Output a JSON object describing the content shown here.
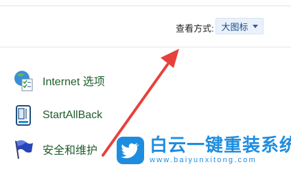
{
  "header": {
    "view_by_label": "查看方式:",
    "view_by_value": "大图标"
  },
  "items": [
    {
      "label": "Internet 选项",
      "icon": "internet-options-icon"
    },
    {
      "label": "StartAllBack",
      "icon": "startallback-icon"
    },
    {
      "label": "安全和维护",
      "icon": "flag-icon"
    }
  ],
  "watermark": {
    "title": "白云一键重装系统",
    "url": "www.baiyunxitong.com"
  },
  "colors": {
    "item_label": "#1e5d2a",
    "arrow": "#e8413b",
    "watermark": "#1f8ddf"
  }
}
